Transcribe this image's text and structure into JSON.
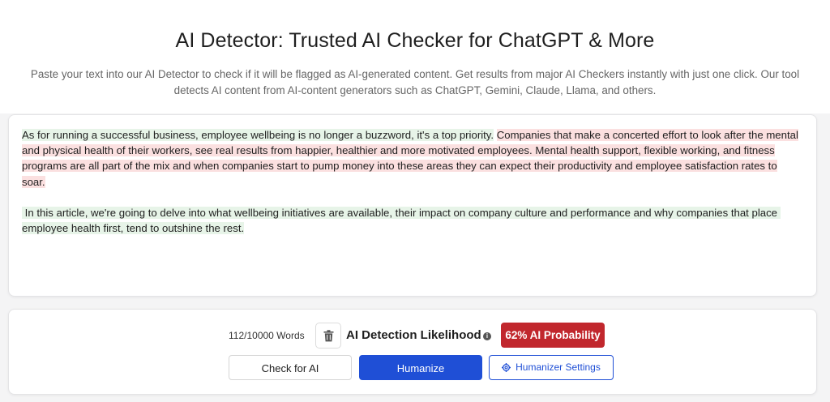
{
  "header": {
    "title": "AI Detector: Trusted AI Checker for ChatGPT & More",
    "subtitle_line1": "Paste your text into our AI Detector to check if it will be flagged as AI-generated content. Get results from major AI Checkers instantly with just one click. Our tool",
    "subtitle_line2": "detects AI content from AI-content generators such as ChatGPT, Gemini, Claude, Llama, and others."
  },
  "editor": {
    "paragraph1_human": "As for running a successful business, employee wellbeing is no longer a buzzword, it's a top priority.",
    "paragraph1_ai": "Companies that make a concerted effort to look after the mental and physical health of their workers, see real results from happier, healthier and more motivated employees. Mental health support, flexible working, and fitness programs are all part of the mix and when companies start to pump money into these areas they can expect their productivity and employee satisfaction rates to soar.",
    "paragraph2_human": " In this article, we're going to delve into what wellbeing initiatives are available, their impact on company culture and performance and why companies that place employee health first, tend to outshine the rest.",
    "colors": {
      "human_highlight": "#e7f4e8",
      "ai_highlight": "#fbe0e0"
    }
  },
  "toolbar": {
    "word_count": "112/10000 Words",
    "trash_icon": "trash-icon",
    "likelihood_label": "AI Detection Likelihood",
    "info_icon": "i",
    "probability_badge": "62% AI Probability",
    "check_label": "Check for AI",
    "humanize_label": "Humanize",
    "settings_label": "Humanizer Settings",
    "settings_icon": "gear-icon",
    "colors": {
      "badge": "#c1272d",
      "primary": "#1f4fd6"
    }
  }
}
